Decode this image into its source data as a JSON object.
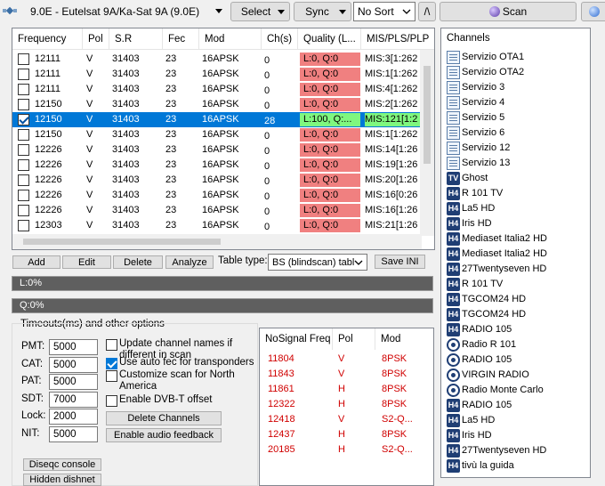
{
  "toolbar": {
    "satellite": "9.0E - Eutelsat 9A/Ka-Sat 9A (9.0E)",
    "select_label": "Select",
    "sync_label": "Sync",
    "sort_value": "No Sort",
    "slash_label": "/\\",
    "scan_label": "Scan"
  },
  "tp_table": {
    "headers": [
      "Frequency",
      "Pol",
      "S.R",
      "Fec",
      "Mod",
      "Ch(s)",
      "Quality (L...",
      "MIS/PLS/PLP"
    ],
    "rows": [
      {
        "checked": false,
        "freq": "12111",
        "pol": "V",
        "sr": "31403",
        "fec": "23",
        "mod": "16APSK",
        "ch": "0",
        "quality": "L:0, Q:0",
        "mis": "MIS:3[1:262"
      },
      {
        "checked": false,
        "freq": "12111",
        "pol": "V",
        "sr": "31403",
        "fec": "23",
        "mod": "16APSK",
        "ch": "0",
        "quality": "L:0, Q:0",
        "mis": "MIS:1[1:262"
      },
      {
        "checked": false,
        "freq": "12111",
        "pol": "V",
        "sr": "31403",
        "fec": "23",
        "mod": "16APSK",
        "ch": "0",
        "quality": "L:0, Q:0",
        "mis": "MIS:4[1:262"
      },
      {
        "checked": false,
        "freq": "12150",
        "pol": "V",
        "sr": "31403",
        "fec": "23",
        "mod": "16APSK",
        "ch": "0",
        "quality": "L:0, Q:0",
        "mis": "MIS:2[1:262"
      },
      {
        "checked": true,
        "freq": "12150",
        "pol": "V",
        "sr": "31403",
        "fec": "23",
        "mod": "16APSK",
        "ch": "28",
        "quality": "L:100, Q:...",
        "mis": "MIS:121[1:2"
      },
      {
        "checked": false,
        "freq": "12150",
        "pol": "V",
        "sr": "31403",
        "fec": "23",
        "mod": "16APSK",
        "ch": "0",
        "quality": "L:0, Q:0",
        "mis": "MIS:1[1:262"
      },
      {
        "checked": false,
        "freq": "12226",
        "pol": "V",
        "sr": "31403",
        "fec": "23",
        "mod": "16APSK",
        "ch": "0",
        "quality": "L:0, Q:0",
        "mis": "MIS:14[1:26"
      },
      {
        "checked": false,
        "freq": "12226",
        "pol": "V",
        "sr": "31403",
        "fec": "23",
        "mod": "16APSK",
        "ch": "0",
        "quality": "L:0, Q:0",
        "mis": "MIS:19[1:26"
      },
      {
        "checked": false,
        "freq": "12226",
        "pol": "V",
        "sr": "31403",
        "fec": "23",
        "mod": "16APSK",
        "ch": "0",
        "quality": "L:0, Q:0",
        "mis": "MIS:20[1:26"
      },
      {
        "checked": false,
        "freq": "12226",
        "pol": "V",
        "sr": "31403",
        "fec": "23",
        "mod": "16APSK",
        "ch": "0",
        "quality": "L:0, Q:0",
        "mis": "MIS:16[0:26"
      },
      {
        "checked": false,
        "freq": "12226",
        "pol": "V",
        "sr": "31403",
        "fec": "23",
        "mod": "16APSK",
        "ch": "0",
        "quality": "L:0, Q:0",
        "mis": "MIS:16[1:26"
      },
      {
        "checked": false,
        "freq": "12303",
        "pol": "V",
        "sr": "31403",
        "fec": "23",
        "mod": "16APSK",
        "ch": "0",
        "quality": "L:0, Q:0",
        "mis": "MIS:21[1:26"
      }
    ]
  },
  "actions": {
    "add": "Add",
    "edit": "Edit",
    "delete": "Delete",
    "analyze": "Analyze",
    "table_type_label": "Table type:",
    "table_type_value": "BS (blindscan) tabl",
    "save_ini": "Save INI"
  },
  "levels": {
    "level_text": "L:0%",
    "quality_text": "Q:0%"
  },
  "options": {
    "group_title": "Timeouts(ms) and other options",
    "timeouts": [
      {
        "label": "PMT:",
        "value": "5000"
      },
      {
        "label": "CAT:",
        "value": "5000"
      },
      {
        "label": "PAT:",
        "value": "5000"
      },
      {
        "label": "SDT:",
        "value": "7000"
      },
      {
        "label": "Lock:",
        "value": "2000"
      },
      {
        "label": "NIT:",
        "value": "5000"
      }
    ],
    "checks": [
      {
        "checked": false,
        "line1": "Update channel names if",
        "line2": "different in scan"
      },
      {
        "checked": true,
        "line1": "Use auto fec for transponders",
        "line2": ""
      },
      {
        "checked": false,
        "line1": "Customize scan for North",
        "line2": "America"
      },
      {
        "checked": false,
        "line1": "Enable DVB-T offset",
        "line2": ""
      }
    ],
    "delete_channels": "Delete Channels",
    "audio_feedback": "Enable audio feedback",
    "diseqc": "Diseqc console",
    "hidden_dishnet": "Hidden dishnet"
  },
  "nosignal": {
    "headers": [
      "NoSignal Freq",
      "Pol",
      "Mod"
    ],
    "rows": [
      {
        "freq": "11804",
        "pol": "V",
        "mod": "8PSK"
      },
      {
        "freq": "11843",
        "pol": "V",
        "mod": "8PSK"
      },
      {
        "freq": "11861",
        "pol": "H",
        "mod": "8PSK"
      },
      {
        "freq": "12322",
        "pol": "H",
        "mod": "8PSK"
      },
      {
        "freq": "12418",
        "pol": "V",
        "mod": "S2-Q..."
      },
      {
        "freq": "12437",
        "pol": "H",
        "mod": "8PSK"
      },
      {
        "freq": "20185",
        "pol": "H",
        "mod": "S2-Q..."
      }
    ]
  },
  "channels": {
    "title": "Channels",
    "items": [
      {
        "icon": "data",
        "name": "Servizio OTA1"
      },
      {
        "icon": "data",
        "name": "Servizio OTA2"
      },
      {
        "icon": "data",
        "name": "Servizio 3"
      },
      {
        "icon": "data",
        "name": "Servizio 4"
      },
      {
        "icon": "data",
        "name": "Servizio 5"
      },
      {
        "icon": "data",
        "name": "Servizio 6"
      },
      {
        "icon": "data",
        "name": "Servizio 12"
      },
      {
        "icon": "data",
        "name": "Servizio 13"
      },
      {
        "icon": "tv",
        "name": "Ghost"
      },
      {
        "icon": "h4",
        "name": "R 101 TV"
      },
      {
        "icon": "h4",
        "name": "La5 HD"
      },
      {
        "icon": "h4",
        "name": "Iris HD"
      },
      {
        "icon": "h4",
        "name": "Mediaset Italia2 HD"
      },
      {
        "icon": "h4",
        "name": "Mediaset Italia2 HD"
      },
      {
        "icon": "h4",
        "name": "27Twentyseven HD"
      },
      {
        "icon": "h4",
        "name": "R 101 TV"
      },
      {
        "icon": "h4",
        "name": "TGCOM24 HD"
      },
      {
        "icon": "h4",
        "name": "TGCOM24 HD"
      },
      {
        "icon": "h4",
        "name": "RADIO 105"
      },
      {
        "icon": "radio",
        "name": "Radio R 101"
      },
      {
        "icon": "radio",
        "name": "RADIO 105"
      },
      {
        "icon": "radio",
        "name": "VIRGIN RADIO"
      },
      {
        "icon": "radio",
        "name": "Radio Monte Carlo"
      },
      {
        "icon": "h4",
        "name": "RADIO 105"
      },
      {
        "icon": "h4",
        "name": "La5 HD"
      },
      {
        "icon": "h4",
        "name": "Iris HD"
      },
      {
        "icon": "h4",
        "name": "27Twentyseven HD"
      },
      {
        "icon": "h4",
        "name": "tivù la guida"
      }
    ]
  },
  "colors": {
    "selected_row": "#0078d7",
    "quality_bad": "#f08080",
    "quality_good": "#7ff77f",
    "nosignal_text": "#d00000"
  }
}
